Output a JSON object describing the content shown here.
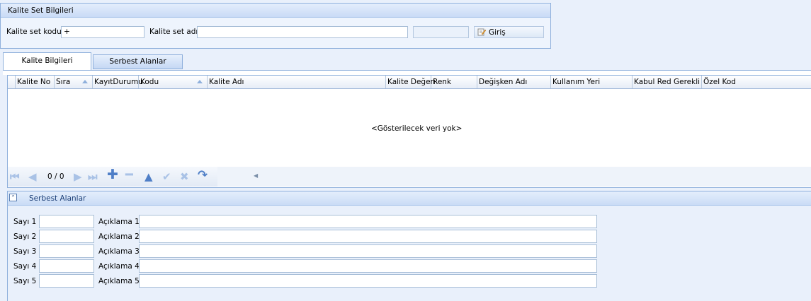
{
  "group": {
    "title": "Kalite Set Bilgileri",
    "code_label": "Kalite set kodu",
    "code_value": "+",
    "name_label": "Kalite set adı",
    "name_value": "",
    "enter_button": "Giriş"
  },
  "tabs": [
    {
      "label": "Kalite Bilgileri",
      "active": true
    },
    {
      "label": "Serbest Alanlar",
      "active": false
    }
  ],
  "grid": {
    "columns": [
      "Kalite No",
      "Sıra",
      "KayıtDurumu",
      "Kodu",
      "Kalite Adı",
      "Kalite Değeri",
      "Renk",
      "Değişken Adı",
      "Kullanım Yeri",
      "Kabul Red Gerekli",
      "Özel Kod"
    ],
    "empty_text": "<Gösterilecek veri yok>",
    "nav_counter": "0 / 0"
  },
  "panel": {
    "title": "Serbest Alanlar",
    "rows": [
      {
        "sayi_label": "Sayı 1",
        "aciklama_label": "Açıklama 1"
      },
      {
        "sayi_label": "Sayı 2",
        "aciklama_label": "Açıklama 2"
      },
      {
        "sayi_label": "Sayı 3",
        "aciklama_label": "Açıklama 3"
      },
      {
        "sayi_label": "Sayı 4",
        "aciklama_label": "Açıklama 4"
      },
      {
        "sayi_label": "Sayı 5",
        "aciklama_label": "Açıklama 5"
      }
    ]
  },
  "colors": {
    "accent": "#4f7fc7",
    "border": "#8fb0dc",
    "background": "#e9f0fb"
  }
}
